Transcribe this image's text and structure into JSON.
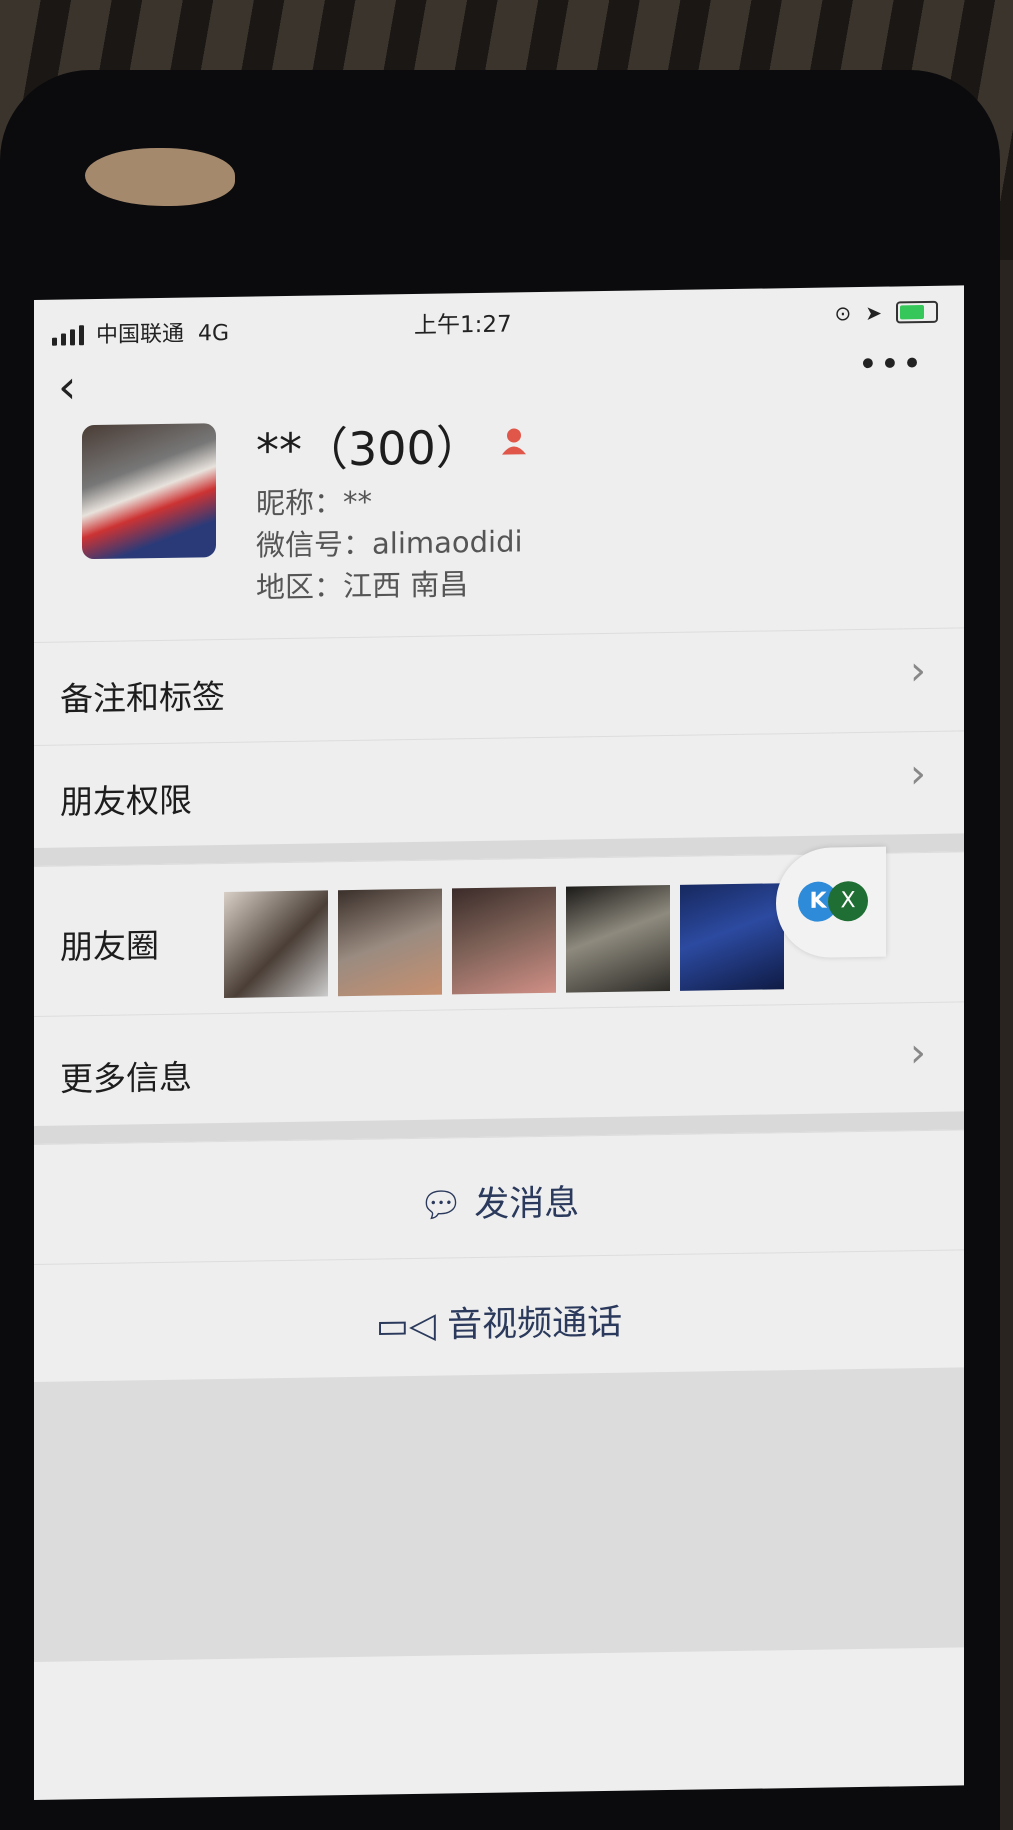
{
  "status_bar": {
    "carrier": "中国联通",
    "network": "4G",
    "time": "上午1:27"
  },
  "nav": {
    "back_icon": "chevron-left-icon",
    "more_icon": "more-dots-icon",
    "more_label": "•••"
  },
  "profile": {
    "name": "**（300）",
    "badge_icon": "person-icon",
    "nickname": "昵称：**",
    "wechat_id": "微信号：alimaodidi",
    "region": "地区：江西 南昌"
  },
  "menu": {
    "remark_tags": "备注和标签",
    "friend_permissions": "朋友权限",
    "moments": "朋友圈",
    "more_info": "更多信息"
  },
  "actions": {
    "send_message": "发消息",
    "video_call": "音视频通话"
  },
  "floating_widget": {
    "k_label": "K",
    "x_label": "X"
  },
  "colors": {
    "action_text": "#2b3a5c",
    "badge": "#e0574a",
    "k_badge": "#2d8bd9",
    "x_badge": "#1f6e34"
  }
}
